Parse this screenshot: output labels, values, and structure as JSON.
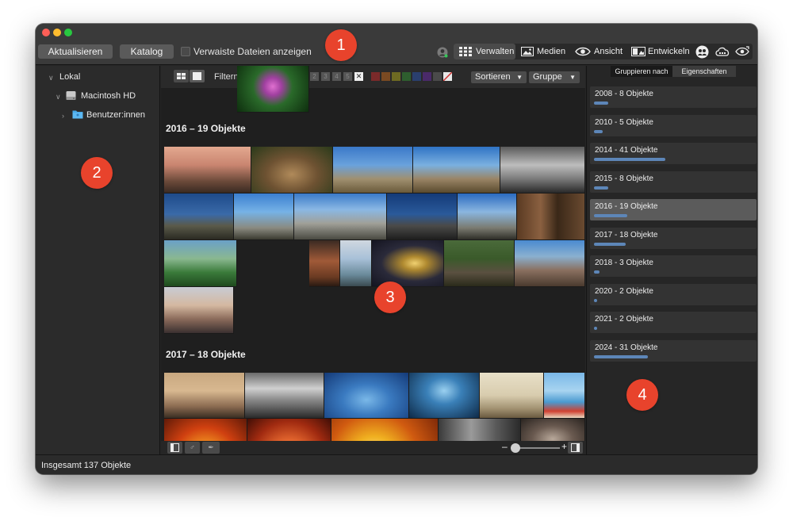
{
  "toolbar": {
    "refresh_label": "Aktualisieren",
    "catalog_label": "Katalog",
    "orphan_checkbox_label": "Verwaiste Dateien anzeigen",
    "modes": [
      {
        "label": "Verwalten",
        "icon": "grid-icon",
        "active": true
      },
      {
        "label": "Medien",
        "icon": "photo-icon",
        "active": false
      },
      {
        "label": "Ansicht",
        "icon": "eye-icon",
        "active": false
      },
      {
        "label": "Entwickeln",
        "icon": "develop-icon",
        "active": false
      }
    ],
    "extra_icons": [
      "people-icon",
      "cloud-icon",
      "eye-refresh-icon"
    ]
  },
  "callouts": [
    "1",
    "2",
    "3",
    "4"
  ],
  "sidebar": {
    "tree": [
      {
        "label": "Lokal",
        "icon": "chevron-down-icon"
      },
      {
        "label": "Macintosh HD",
        "icon": "hard-drive-icon"
      },
      {
        "label": "Benutzer:innen",
        "icon": "folder-icon"
      }
    ]
  },
  "filterbar": {
    "filter_label": "Filtern nach:",
    "ratings": [
      "1",
      "2",
      "3",
      "4",
      "5"
    ],
    "colors": [
      "#7a2a2a",
      "#7a4a22",
      "#6e6a22",
      "#2e5e2e",
      "#2a3f6e",
      "#4a2a6a",
      "#4a4a4a"
    ],
    "sort_label": "Sortieren",
    "group_label": "Gruppe"
  },
  "groups": [
    {
      "title": "2016 – 19 Objekte"
    },
    {
      "title": "2017 – 18 Objekte"
    }
  ],
  "right_panel": {
    "tab_group": "Gruppieren nach",
    "tab_props": "Eigenschaften",
    "years": [
      {
        "label": "2008 - 8 Objekte",
        "count": 8
      },
      {
        "label": "2010 - 5 Objekte",
        "count": 5
      },
      {
        "label": "2014 - 41 Objekte",
        "count": 41
      },
      {
        "label": "2015 - 8 Objekte",
        "count": 8
      },
      {
        "label": "2016 - 19 Objekte",
        "count": 19,
        "selected": true
      },
      {
        "label": "2017 - 18 Objekte",
        "count": 18
      },
      {
        "label": "2018 - 3 Objekte",
        "count": 3
      },
      {
        "label": "2020 - 2 Objekte",
        "count": 2
      },
      {
        "label": "2021 - 2 Objekte",
        "count": 2
      },
      {
        "label": "2024 - 31 Objekte",
        "count": 31
      }
    ]
  },
  "status": {
    "total": "Insgesamt 137 Objekte"
  },
  "colors": {
    "accent": "#5d86b8",
    "callout": "#e8432c"
  }
}
